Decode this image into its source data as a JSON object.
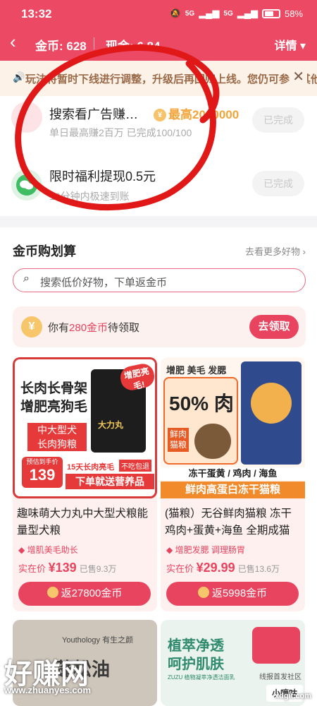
{
  "status": {
    "time": "13:32",
    "network": "5G",
    "battery": "58%"
  },
  "header": {
    "coins": "金币: 628",
    "cash": "现金: 6.84",
    "detail": "详情"
  },
  "notice": {
    "text": "玩法将暂时下线进行调整，升级后再回归上线。您仍可参与其他玩法"
  },
  "tasks": [
    {
      "title": "搜索看广告赚…",
      "badge": "最高2000000",
      "sub": "单日最高赚2百万 已完成100/100",
      "button": "已完成"
    },
    {
      "title": "限时福利提现0.5元",
      "sub": "10分钟内极速到账",
      "button": "已完成"
    }
  ],
  "shop": {
    "heading": "金币购划算",
    "more": "去看更多好物 ›",
    "search_placeholder": "搜索低价好物，下单返金币",
    "claim_prefix": "你有",
    "claim_amount": "280金币",
    "claim_suffix": "待领取",
    "claim_button": "去领取",
    "products": [
      {
        "img_text1": "长肉长骨架",
        "img_text2": "增肥亮狗毛",
        "img_text3": "中大型犬",
        "img_text4": "长肉狗粮",
        "img_badge": "增肥亮毛!",
        "img_bag": "大力丸",
        "img_price_tag": "预估到手价",
        "img_price": "139",
        "img_promo1": "15天长肉亮毛",
        "img_promo1b": "不吃包退",
        "img_promo2": "下单就送营养品",
        "title": "趣味萌大力丸中大型犬粮能量型犬粮",
        "tag": "增肌美毛助长",
        "price_label": "实在价",
        "price": "¥139",
        "sold": "已售9.3万",
        "button": "返27800金币"
      },
      {
        "img_top": "增肥 美毛 发腮",
        "img_big": "50% 肉",
        "img_side": "鲜肉猫粮",
        "img_strip1": "冻干蛋黄 / 鸡肉 / 海鱼",
        "img_strip2": "鲜肉高蛋白冻干猫粮",
        "title": "(猫粮）无谷鲜肉猫粮 冻干鸡肉+蛋黄+海鱼 全期成猫",
        "tag": "增肥发腮 调理肠胃",
        "price_label": "实在价",
        "price": "¥29.99",
        "sold": "已售13.6万",
        "button": "返5998金币"
      }
    ],
    "bottom_cards": [
      {
        "brand": "Youthology 有生之颜",
        "text": "蓬松油"
      },
      {
        "line1": "植萃净透",
        "line2": "呵护肌肤",
        "small": "ZUZU 植物凝萃净透洁面乳",
        "chip": "小嘀咕",
        "side": "线报首发社区"
      }
    ]
  },
  "watermark": {
    "left": "好赚网",
    "left_url": "www.zhuanyes.com",
    "right": "xdgit.com"
  }
}
